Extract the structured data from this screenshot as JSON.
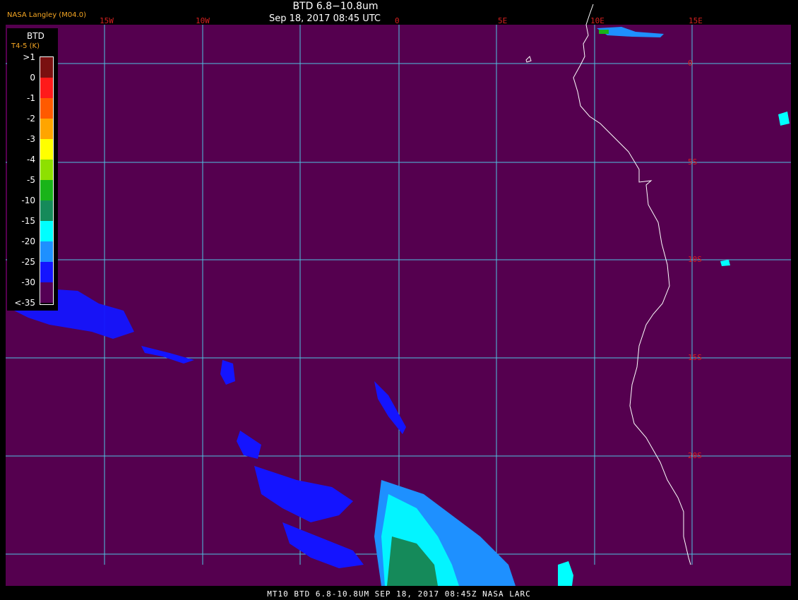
{
  "header": {
    "title": "BTD 6.8−10.8um",
    "datetime": "Sep 18, 2017 08:45 UTC",
    "organization": "NASA Langley (M04.0)"
  },
  "footer": {
    "text": "MT10  BTD 6.8-10.8UM   SEP 18, 2017 08:45Z   NASA LARC"
  },
  "grid": {
    "color": "#4fc3e0",
    "longitude_labels": [
      "15W",
      "10W",
      "0",
      "5E",
      "10E",
      "15E"
    ],
    "latitude_labels": [
      "0",
      "5S",
      "10S",
      "15S",
      "20S"
    ]
  },
  "legend": {
    "title": "BTD",
    "unit": "T4-5 (K)",
    "levels": [
      {
        "label": ">1",
        "color": "#7a1010"
      },
      {
        "label": "0",
        "color": "#ff1a1a"
      },
      {
        "label": "-1",
        "color": "#ff5a00"
      },
      {
        "label": "-2",
        "color": "#ffa500"
      },
      {
        "label": "-3",
        "color": "#ffff00"
      },
      {
        "label": "-4",
        "color": "#8ee000"
      },
      {
        "label": "-5",
        "color": "#19b419"
      },
      {
        "label": "-10",
        "color": "#158a5a"
      },
      {
        "label": "-15",
        "color": "#00ffff"
      },
      {
        "label": "-20",
        "color": "#1e90ff"
      },
      {
        "label": "-25",
        "color": "#1414ff"
      },
      {
        "label": "-30",
        "color": "#550055"
      },
      {
        "label": "<-35",
        "color": ""
      }
    ]
  },
  "colors": {
    "background": "#55004f",
    "coastline": "#ffffff",
    "grid_label": "#d42020",
    "header_text": "#ffffff",
    "organization_text": "#f5a623"
  }
}
